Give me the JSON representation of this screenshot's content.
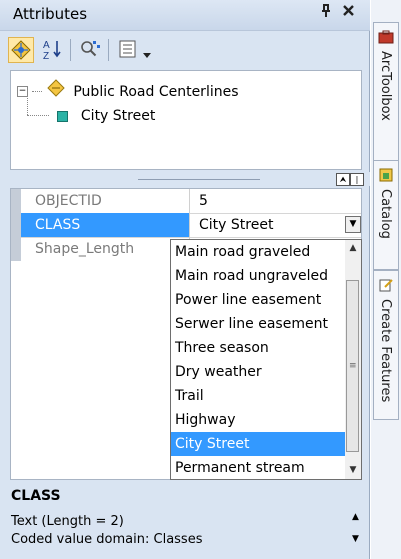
{
  "window": {
    "title": "Attributes",
    "pin_glyph": "ᵖ",
    "close_glyph": "✕"
  },
  "toolbar": {
    "buttons": [
      {
        "icon": "select-features-icon"
      },
      {
        "icon": "sort-az-icon"
      },
      {
        "icon": "find-identify-icon"
      },
      {
        "icon": "options-menu-icon",
        "has_dropdown": true
      }
    ]
  },
  "tree": {
    "layer_label": "Public Road Centerlines",
    "feature_label": "City Street"
  },
  "grid": {
    "rows": [
      {
        "field": "OBJECTID",
        "value": "5"
      },
      {
        "field": "CLASS",
        "value": "City Street"
      },
      {
        "field": "Shape_Length",
        "value": ""
      }
    ]
  },
  "dropdown": {
    "options": [
      "Main road graveled",
      "Main road ungraveled",
      "Power line easement",
      "Serwer line easement",
      "Three season",
      "Dry weather",
      "Trail",
      "Highway",
      "City Street",
      "Permanent stream"
    ],
    "selected": "City Street"
  },
  "description": {
    "title": "CLASS",
    "line1": "Text (Length = 2)",
    "line2": "Coded value domain: Classes"
  },
  "sidebar": {
    "tabs": [
      {
        "label": "ArcToolbox",
        "icon": "arctoolbox-icon"
      },
      {
        "label": "Catalog",
        "icon": "catalog-icon"
      },
      {
        "label": "Create Features",
        "icon": "create-features-icon"
      }
    ]
  },
  "colors": {
    "panel_bg": "#d9e4f2",
    "selection": "#3399ff",
    "gutter": "#c5cdd8"
  }
}
